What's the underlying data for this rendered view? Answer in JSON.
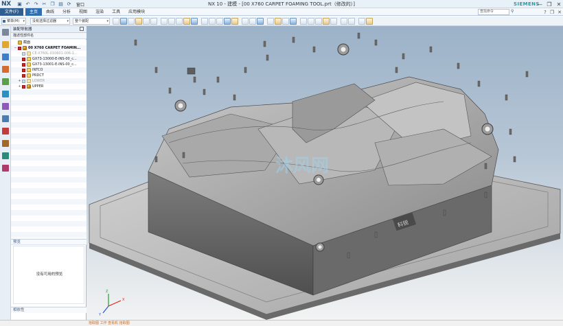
{
  "app": {
    "logo": "NX",
    "title": "NX 10 - 建模 - [00 X760 CARPET FOAMING TOOL.prt（修改的）]",
    "brand": "SIEMENS",
    "window_menu_label": "窗口",
    "window_controls": [
      "—",
      "❐",
      "✕"
    ]
  },
  "ribbon": {
    "file_tab": "文件(F)",
    "tabs": [
      "主页",
      "曲线",
      "分析",
      "视图",
      "渲染",
      "工具",
      "应用模块"
    ],
    "active_tab": "主页",
    "command_finder_placeholder": "查找命令"
  },
  "toolbar": {
    "menu_label": "菜单(M)",
    "selection_filter": "没有选择过滤器",
    "scope": "整个装配"
  },
  "navigator": {
    "title": "装配导航器",
    "column_header": "描述性部件名",
    "rows": [
      {
        "indent": 0,
        "expand": "",
        "checked": null,
        "icon": "folder",
        "label": "截面",
        "style": "normal"
      },
      {
        "indent": 0,
        "expand": "−",
        "checked": true,
        "icon": "asm",
        "label": "00 X760 CARPET FOAMIN...",
        "style": "bold"
      },
      {
        "indent": 1,
        "expand": "",
        "checked": false,
        "icon": "dim",
        "label": "CE-X760L-010601-006-1...",
        "style": "dim"
      },
      {
        "indent": 1,
        "expand": "",
        "checked": true,
        "icon": "part",
        "label": "GX73-13000-E-INS-00_c...",
        "style": "normal"
      },
      {
        "indent": 1,
        "expand": "",
        "checked": true,
        "icon": "part",
        "label": "GX73-13001-E-INS-00_c...",
        "style": "normal"
      },
      {
        "indent": 1,
        "expand": "",
        "checked": true,
        "icon": "part",
        "label": "INTCO",
        "style": "normal"
      },
      {
        "indent": 1,
        "expand": "",
        "checked": true,
        "icon": "part",
        "label": "PRDCT",
        "style": "normal"
      },
      {
        "indent": 1,
        "expand": "+",
        "checked": false,
        "icon": "dim",
        "label": "LOWER",
        "style": "dim"
      },
      {
        "indent": 1,
        "expand": "+",
        "checked": true,
        "icon": "asm",
        "label": "UPPER",
        "style": "normal"
      }
    ],
    "preview_title": "预览",
    "preview_empty_text": "没有可用的预览",
    "dependency_title": "相依性"
  },
  "resource_bar": {
    "icons": [
      "settings-icon",
      "assembly-navigator-icon",
      "constraint-navigator-icon",
      "part-navigator-icon",
      "reuse-library-icon",
      "hd3d-tools-icon",
      "web-browser-icon",
      "history-icon",
      "process-studio-icon",
      "roles-icon",
      "system-materials-icon",
      "system-scenes-icon"
    ]
  },
  "model": {
    "engraving": "科锐",
    "watermark": "沐风网"
  },
  "status": {
    "left": "拾取图 工作 查看机 拾取图",
    "right": ""
  },
  "colors": {
    "accent": "#2f6fb0",
    "file_tab": "#2f5e93",
    "brand": "#1f9eaa",
    "check": "#d22222"
  }
}
